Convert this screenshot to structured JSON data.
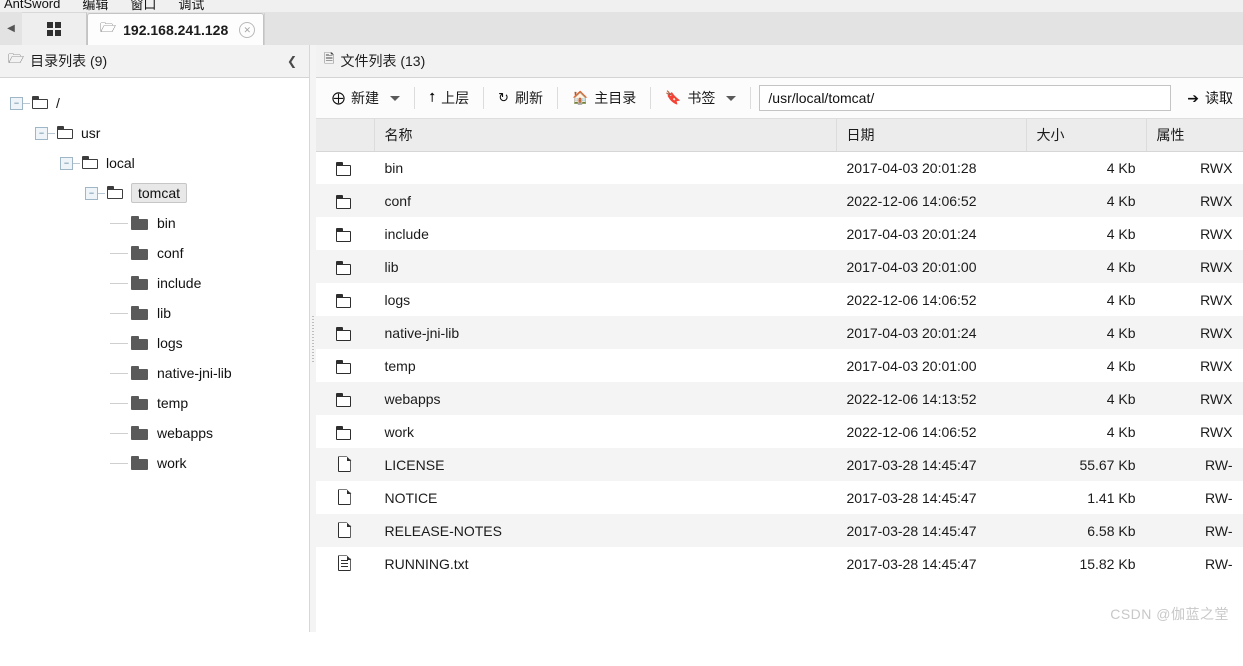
{
  "menu": {
    "items": [
      "AntSword",
      "编辑",
      "窗口",
      "调试"
    ]
  },
  "tabs": {
    "nav_prev_icon": "chevron-left-icon",
    "grid_icon": "grid-icon",
    "active": {
      "folder_icon": "folder-icon",
      "label": "192.168.241.128",
      "close_icon": "close-icon"
    }
  },
  "sidebar": {
    "title": "目录列表 (9)",
    "title_icon": "folder-outline-icon",
    "collapse_icon": "chevron-left-icon",
    "tree": [
      {
        "label": "/",
        "depth": 0,
        "expanded": true,
        "selected": false
      },
      {
        "label": "usr",
        "depth": 1,
        "expanded": true,
        "selected": false
      },
      {
        "label": "local",
        "depth": 2,
        "expanded": true,
        "selected": false
      },
      {
        "label": "tomcat",
        "depth": 3,
        "expanded": true,
        "selected": true
      },
      {
        "label": "bin",
        "depth": 4,
        "expanded": false,
        "selected": false
      },
      {
        "label": "conf",
        "depth": 4,
        "expanded": false,
        "selected": false
      },
      {
        "label": "include",
        "depth": 4,
        "expanded": false,
        "selected": false
      },
      {
        "label": "lib",
        "depth": 4,
        "expanded": false,
        "selected": false
      },
      {
        "label": "logs",
        "depth": 4,
        "expanded": false,
        "selected": false
      },
      {
        "label": "native-jni-lib",
        "depth": 4,
        "expanded": false,
        "selected": false
      },
      {
        "label": "temp",
        "depth": 4,
        "expanded": false,
        "selected": false
      },
      {
        "label": "webapps",
        "depth": 4,
        "expanded": false,
        "selected": false
      },
      {
        "label": "work",
        "depth": 4,
        "expanded": false,
        "selected": false
      }
    ]
  },
  "main": {
    "title": "文件列表 (13)",
    "title_icon": "file-outline-icon",
    "toolbar": {
      "new_label": "新建",
      "new_icon": "plus-circle-icon",
      "up_label": "上层",
      "up_icon": "arrow-up-icon",
      "refresh_label": "刷新",
      "refresh_icon": "refresh-icon",
      "home_label": "主目录",
      "home_icon": "home-icon",
      "bookmark_label": "书签",
      "bookmark_icon": "bookmark-icon",
      "read_label": "读取",
      "read_icon": "arrow-right-icon"
    },
    "path": {
      "value": "/usr/local/tomcat/",
      "placeholder": "/usr/local/tomcat/"
    },
    "columns": {
      "name": "名称",
      "date": "日期",
      "size": "大小",
      "attr": "属性"
    },
    "rows": [
      {
        "icon": "folder-icon",
        "name": "bin",
        "date": "2017-04-03 20:01:28",
        "size": "4 Kb",
        "attr": "RWX"
      },
      {
        "icon": "folder-icon",
        "name": "conf",
        "date": "2022-12-06 14:06:52",
        "size": "4 Kb",
        "attr": "RWX"
      },
      {
        "icon": "folder-icon",
        "name": "include",
        "date": "2017-04-03 20:01:24",
        "size": "4 Kb",
        "attr": "RWX"
      },
      {
        "icon": "folder-icon",
        "name": "lib",
        "date": "2017-04-03 20:01:00",
        "size": "4 Kb",
        "attr": "RWX"
      },
      {
        "icon": "folder-icon",
        "name": "logs",
        "date": "2022-12-06 14:06:52",
        "size": "4 Kb",
        "attr": "RWX"
      },
      {
        "icon": "folder-icon",
        "name": "native-jni-lib",
        "date": "2017-04-03 20:01:24",
        "size": "4 Kb",
        "attr": "RWX"
      },
      {
        "icon": "folder-icon",
        "name": "temp",
        "date": "2017-04-03 20:01:00",
        "size": "4 Kb",
        "attr": "RWX"
      },
      {
        "icon": "folder-icon",
        "name": "webapps",
        "date": "2022-12-06 14:13:52",
        "size": "4 Kb",
        "attr": "RWX"
      },
      {
        "icon": "folder-icon",
        "name": "work",
        "date": "2022-12-06 14:06:52",
        "size": "4 Kb",
        "attr": "RWX"
      },
      {
        "icon": "file-icon",
        "name": "LICENSE",
        "date": "2017-03-28 14:45:47",
        "size": "55.67 Kb",
        "attr": "RW-"
      },
      {
        "icon": "file-icon",
        "name": "NOTICE",
        "date": "2017-03-28 14:45:47",
        "size": "1.41 Kb",
        "attr": "RW-"
      },
      {
        "icon": "file-icon",
        "name": "RELEASE-NOTES",
        "date": "2017-03-28 14:45:47",
        "size": "6.58 Kb",
        "attr": "RW-"
      },
      {
        "icon": "text-file-icon",
        "name": "RUNNING.txt",
        "date": "2017-03-28 14:45:47",
        "size": "15.82 Kb",
        "attr": "RW-"
      }
    ]
  },
  "watermark": "CSDN @伽蓝之堂",
  "colors": {
    "chrome": "#e3e3e3",
    "header": "#ececec",
    "row_alt": "#f4f4f4",
    "selection": "#e8e8e8",
    "folder_solid": "#5a5a5a"
  }
}
